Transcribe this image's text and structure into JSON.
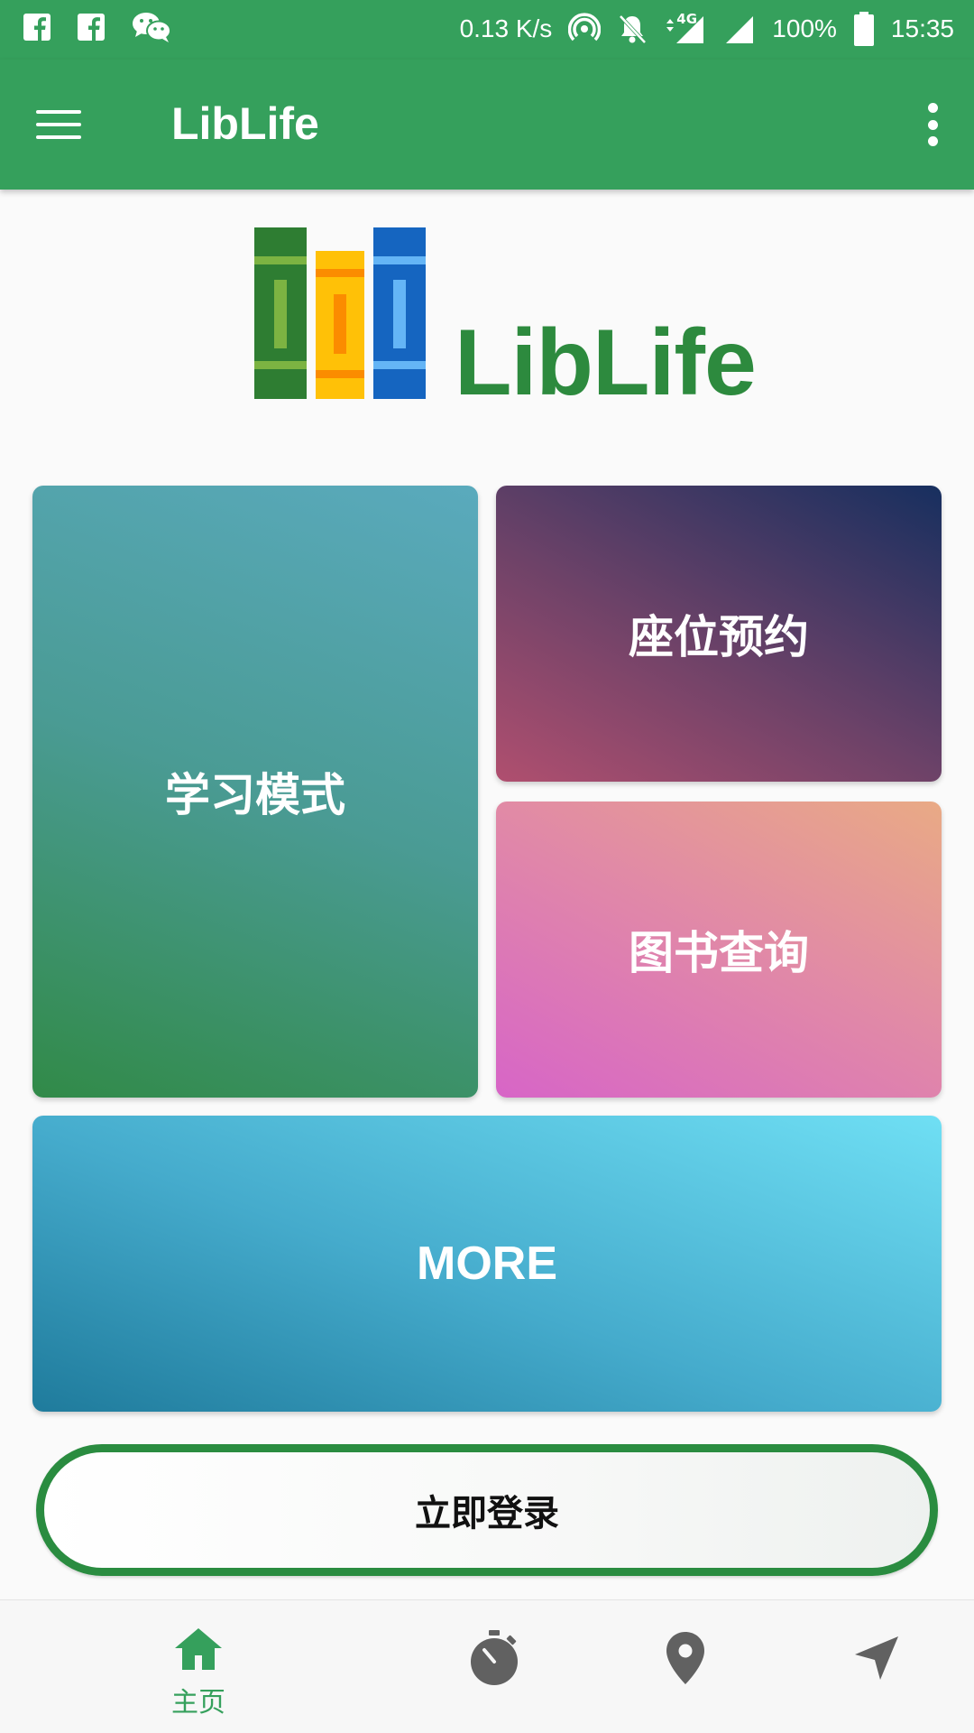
{
  "status_bar": {
    "network_speed": "0.13 K/s",
    "network_type": "4G",
    "battery": "100%",
    "time": "15:35"
  },
  "app_bar": {
    "title": "LibLife"
  },
  "logo": {
    "text": "LibLife"
  },
  "tiles": {
    "study": "学习模式",
    "seat": "座位预约",
    "book": "图书查询",
    "more": "MORE"
  },
  "login_button": "立即登录",
  "bottom_nav": {
    "home_label": "主页",
    "icons": [
      "home-icon",
      "stopwatch-icon",
      "location-pin-icon",
      "navigation-icon"
    ]
  },
  "colors": {
    "primary": "#35a05c",
    "logo_green": "#2d8a3e",
    "login_border": "#2a8c40",
    "inactive_icon": "#616161"
  }
}
